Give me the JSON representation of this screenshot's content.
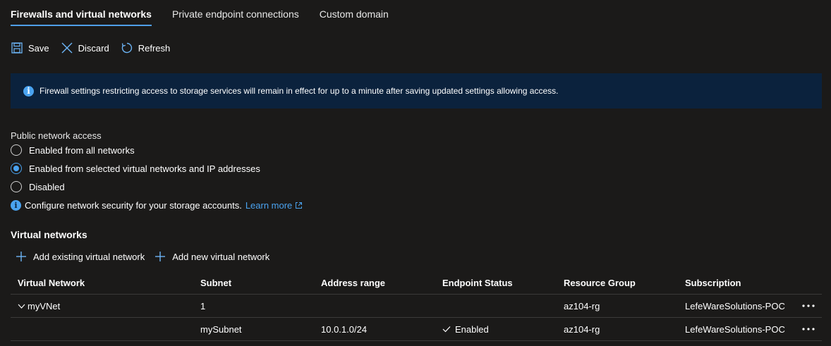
{
  "tabs": [
    {
      "label": "Firewalls and virtual networks"
    },
    {
      "label": "Private endpoint connections"
    },
    {
      "label": "Custom domain"
    }
  ],
  "toolbar": {
    "save_label": "Save",
    "discard_label": "Discard",
    "refresh_label": "Refresh"
  },
  "banner": {
    "text": "Firewall settings restricting access to storage services will remain in effect for up to a minute after saving updated settings allowing access."
  },
  "public_access": {
    "label": "Public network access",
    "options": [
      {
        "label": "Enabled from all networks"
      },
      {
        "label": "Enabled from selected virtual networks and IP addresses"
      },
      {
        "label": "Disabled"
      }
    ],
    "selected": "Enabled from selected virtual networks and IP addresses"
  },
  "config_note": {
    "text": "Configure network security for your storage accounts.",
    "link": "Learn more"
  },
  "virtual_networks": {
    "title": "Virtual networks",
    "add_existing": "Add existing virtual network",
    "add_new": "Add new virtual network",
    "columns": [
      "Virtual Network",
      "Subnet",
      "Address range",
      "Endpoint Status",
      "Resource Group",
      "Subscription"
    ],
    "rows": [
      {
        "vnet": "myVNet",
        "subnet": "1",
        "address": "",
        "status": "",
        "rg": "az104-rg",
        "subscription": "LefeWareSolutions-POC"
      },
      {
        "vnet": "",
        "subnet": "mySubnet",
        "address": "10.0.1.0/24",
        "status": "Enabled",
        "rg": "az104-rg",
        "subscription": "LefeWareSolutions-POC"
      }
    ]
  },
  "colors": {
    "background": "#1b1a19",
    "accent": "#4aa3f0",
    "banner": "#0b223d"
  }
}
